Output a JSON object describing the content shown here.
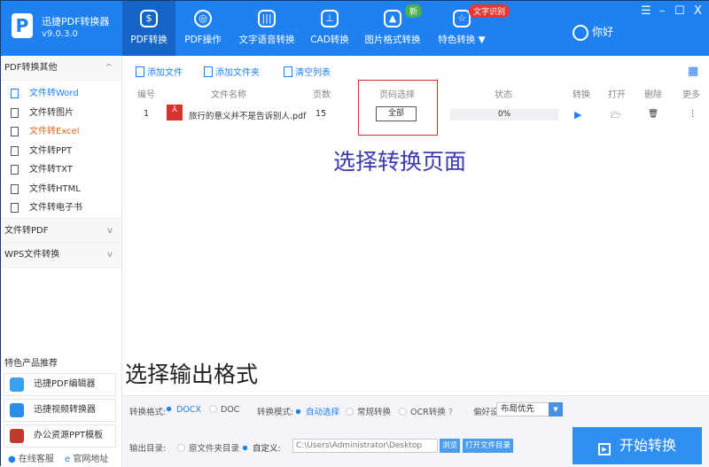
{
  "app": {
    "name": "迅捷PDF转换器",
    "version": "v9.0.3.0",
    "logo": "P"
  },
  "tabs": [
    {
      "label": "PDF转换",
      "icon": "convert-icon",
      "active": true
    },
    {
      "label": "PDF操作",
      "icon": "gear-icon"
    },
    {
      "label": "文字语音转换",
      "icon": "voice-icon"
    },
    {
      "label": "CAD转换",
      "icon": "cad-icon"
    },
    {
      "label": "图片格式转换",
      "icon": "image-icon",
      "badge": "新"
    },
    {
      "label": "特色转换 ▼",
      "icon": "special-icon",
      "badge": "文字识别"
    }
  ],
  "user": {
    "greeting": "你好"
  },
  "window": {
    "menu": "☰",
    "min": "–",
    "max": "☐",
    "close": "X"
  },
  "sidebar": {
    "group1": "PDF转换其他",
    "items": [
      "文件转Word",
      "文件转图片",
      "文件转Excel",
      "文件转PPT",
      "文件转TXT",
      "文件转HTML",
      "文件转电子书"
    ],
    "group2": "文件转PDF",
    "group3": "WPS文件转换",
    "recommend_title": "特色产品推荐",
    "products": [
      "迅捷PDF编辑器",
      "迅捷视频转换器",
      "办公资源PPT模板"
    ],
    "footer": [
      "在线客服",
      "官网地址"
    ]
  },
  "toolbar": {
    "add_file": "添加文件",
    "add_folder": "添加文件夹",
    "clear": "清空列表"
  },
  "table": {
    "headers": [
      "编号",
      "文件名称",
      "页数",
      "页码选择",
      "状态",
      "转换",
      "打开",
      "删除",
      "更多"
    ],
    "rows": [
      {
        "index": "1",
        "name": "旅行的意义并不是告诉别人.pdf",
        "pages": "15",
        "page_select": "全部",
        "progress": "0%"
      }
    ]
  },
  "annotations": {
    "page_select": "选择转换页面",
    "output_format": "选择输出格式"
  },
  "options": {
    "format_label": "转换格式:",
    "formats": [
      "DOCX",
      "DOC"
    ],
    "format_selected": "DOCX",
    "mode_label": "转换模式:",
    "modes": [
      "自动选择",
      "常规转换",
      "OCR转换"
    ],
    "mode_selected": "自动选择",
    "pref_label": "偏好设置:",
    "pref_value": "布局优先",
    "output_label": "输出目录:",
    "output_opts": [
      "原文件夹目录",
      "自定义:"
    ],
    "output_selected": "自定义:",
    "path": "C:\\Users\\Administrator\\Desktop",
    "browse": "浏览",
    "open_dir": "打开文件目录",
    "start": "开始转换"
  }
}
